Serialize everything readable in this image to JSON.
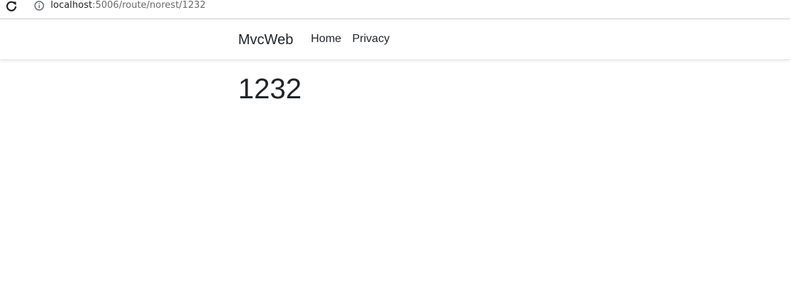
{
  "browser": {
    "address_host": "localhost",
    "address_path": ":5006/route/norest/1232",
    "icons": [
      "reload-icon",
      "info-icon"
    ]
  },
  "navbar": {
    "brand": "MvcWeb",
    "links": [
      {
        "label": "Home"
      },
      {
        "label": "Privacy"
      }
    ]
  },
  "main": {
    "heading": "1232"
  },
  "colors": {
    "text": "#212529",
    "address_path": "#6b6b6b",
    "background": "#ffffff"
  }
}
